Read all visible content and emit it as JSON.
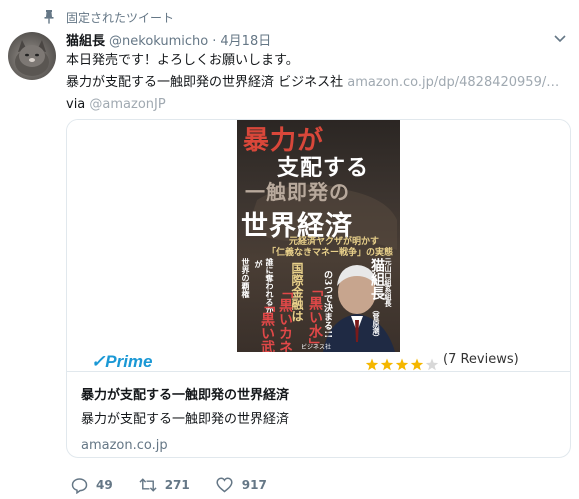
{
  "pinned": {
    "label": "固定されたツイート",
    "icon": "pin-icon"
  },
  "author": {
    "name": "猫組長",
    "handle": "@nekokumicho",
    "separator": "·",
    "date": "4月18日"
  },
  "tweet": {
    "line1": "本日発売です！よろしくお願いします。",
    "line2_text": "暴力が支配する一触即発の世界経済 ビジネス社 ",
    "line2_link": "amazon.co.jp/dp/4828420959/…",
    "via_prefix": "via ",
    "via_link": "@amazonJP"
  },
  "card": {
    "book_cover": {
      "title_line1": "暴力が",
      "title_line2": "支配する",
      "title_line3": "一触即発の",
      "title_line4": "世界経済",
      "subtitle1": "元経済ヤクザが明かす",
      "subtitle2": "「仁義なきマネー戦争」の実態",
      "author_label": "元山口組系組長",
      "author_name": "猫組長",
      "author_reading": "（菅原潮）",
      "tag1": "国際金融は",
      "tag2": "「黒い武器」",
      "tag3": "「黒いカネ」",
      "tag4": "「黒い水」",
      "tag5": "の3つで決まる!!",
      "side1": "世界の覇権",
      "side2": "が",
      "side3": "誰に奪われるか",
      "publisher": "ビジネス社"
    },
    "prime_label": "✓Prime",
    "rating": 4,
    "rating_max": 5,
    "reviews": "(7 Reviews)",
    "title": "暴力が支配する一触即発の世界経済",
    "description": "暴力が支配する一触即発の世界経済",
    "domain": "amazon.co.jp"
  },
  "actions": [
    {
      "icon": "reply-icon",
      "count": "49"
    },
    {
      "icon": "retweet-icon",
      "count": "271"
    },
    {
      "icon": "like-icon",
      "count": "917"
    }
  ],
  "colors": {
    "secondary_text": "#657786",
    "link_muted": "#a0a9b1",
    "border": "#e1e8ed",
    "prime_blue": "#1a98d5",
    "star": "#f5b700"
  }
}
